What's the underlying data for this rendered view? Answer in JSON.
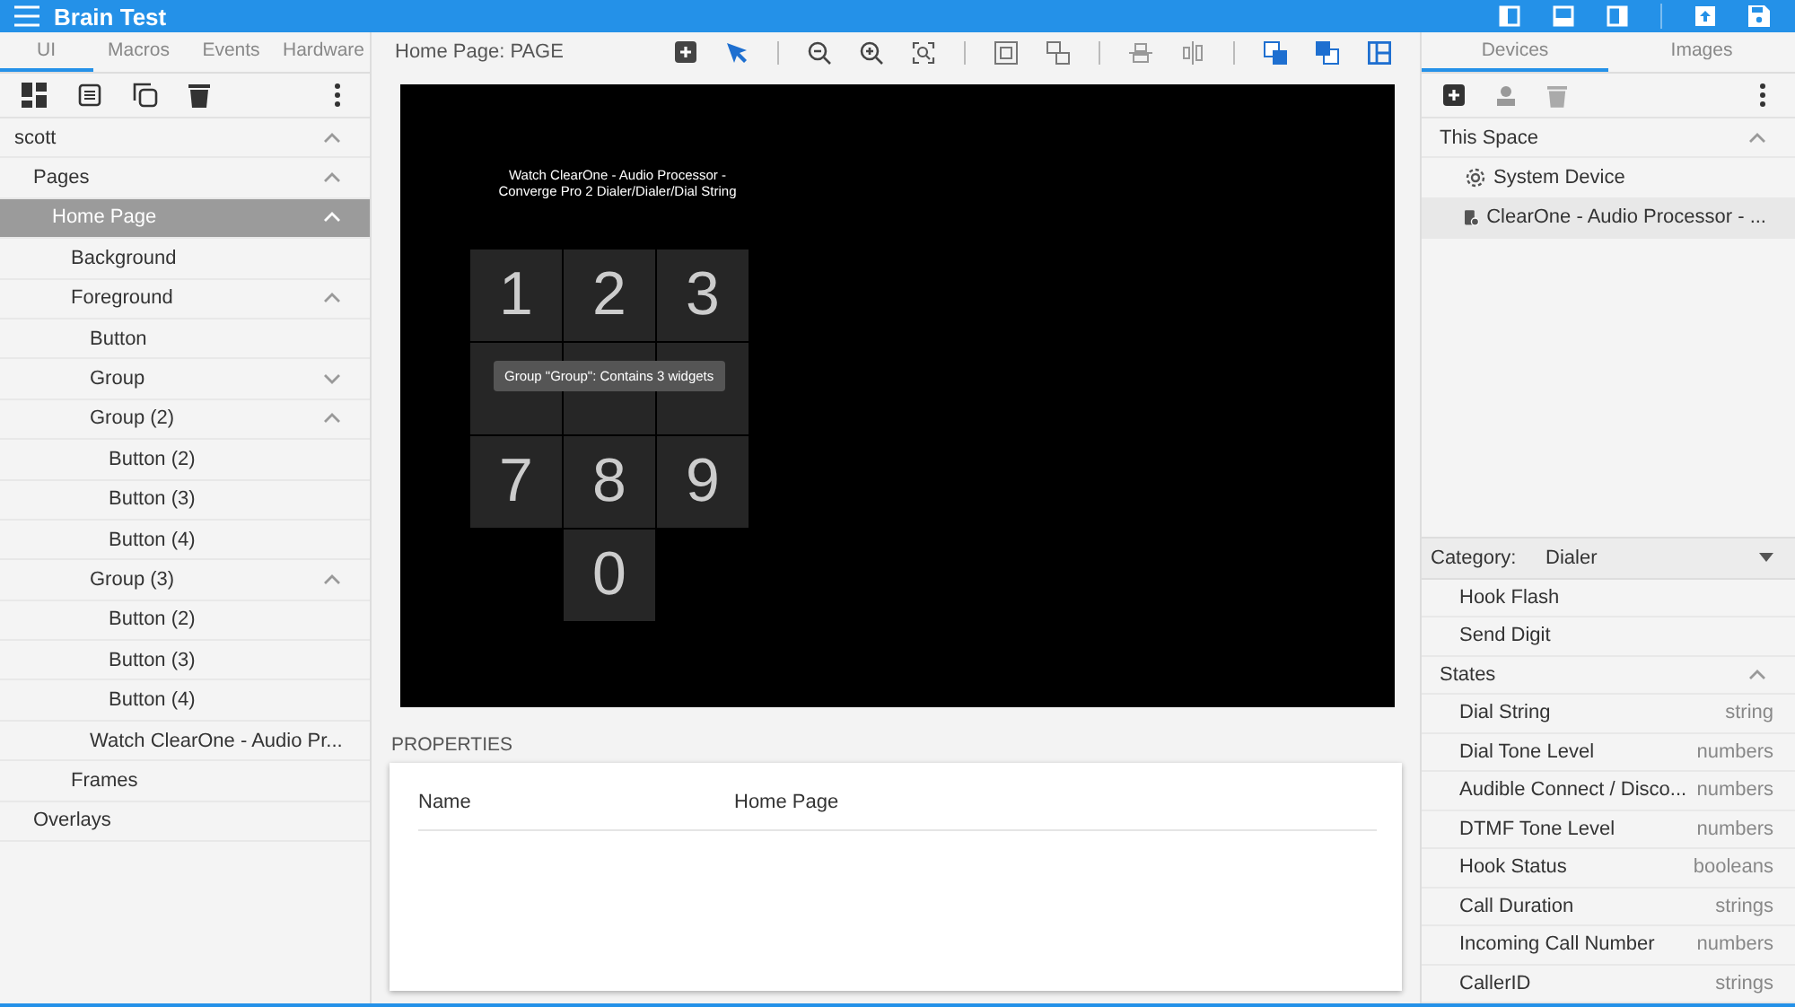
{
  "app_bar": {
    "title": "Brain Test"
  },
  "left_panel": {
    "tabs": [
      {
        "label": "UI",
        "selected": true
      },
      {
        "label": "Macros",
        "selected": false
      },
      {
        "label": "Events",
        "selected": false
      },
      {
        "label": "Hardware",
        "selected": false
      }
    ],
    "tree": [
      {
        "label": "scott",
        "selected": false,
        "expanded": true,
        "children": [
          {
            "label": "Pages",
            "selected": false,
            "expanded": true,
            "children": [
              {
                "label": "Home Page",
                "selected": true,
                "expanded": true,
                "children": [
                  {
                    "label": "Background",
                    "selected": false
                  },
                  {
                    "label": "Foreground",
                    "selected": false,
                    "expanded": true,
                    "children": [
                      {
                        "label": "Button",
                        "selected": false
                      },
                      {
                        "label": "Group",
                        "selected": false,
                        "expanded": false
                      },
                      {
                        "label": "Group (2)",
                        "selected": false,
                        "expanded": true,
                        "children": [
                          {
                            "label": "Button (2)",
                            "selected": false
                          },
                          {
                            "label": "Button (3)",
                            "selected": false
                          },
                          {
                            "label": "Button (4)",
                            "selected": false
                          }
                        ]
                      },
                      {
                        "label": "Group (3)",
                        "selected": false,
                        "expanded": true,
                        "children": [
                          {
                            "label": "Button (2)",
                            "selected": false
                          },
                          {
                            "label": "Button (3)",
                            "selected": false
                          },
                          {
                            "label": "Button (4)",
                            "selected": false
                          }
                        ]
                      },
                      {
                        "label": "Watch ClearOne - Audio Pr...",
                        "selected": false
                      }
                    ]
                  },
                  {
                    "label": "Frames",
                    "selected": false
                  }
                ]
              }
            ]
          },
          {
            "label": "Overlays",
            "selected": false
          }
        ]
      }
    ]
  },
  "editor": {
    "title": "Home Page: PAGE",
    "canvas": {
      "caption": "Watch ClearOne - Audio Processor -\nConverge Pro 2 Dialer/Dialer/Dial String",
      "keys": [
        {
          "kind": "digit",
          "label": "1"
        },
        {
          "kind": "digit",
          "label": "2"
        },
        {
          "kind": "digit",
          "label": "3"
        },
        {
          "kind": "hidden"
        },
        {
          "kind": "hidden"
        },
        {
          "kind": "hidden"
        },
        {
          "kind": "digit",
          "label": "7"
        },
        {
          "kind": "digit",
          "label": "8"
        },
        {
          "kind": "digit",
          "label": "9"
        },
        {
          "kind": "digit",
          "label": "0"
        }
      ],
      "tooltip": "Group \"Group\": Contains 3 widgets"
    },
    "properties": {
      "heading": "PROPERTIES",
      "rows": [
        {
          "name": "Name",
          "value": "Home Page"
        }
      ]
    }
  },
  "right_panel": {
    "tabs": [
      {
        "label": "Devices",
        "selected": true
      },
      {
        "label": "Images",
        "selected": false
      }
    ],
    "space": {
      "title": "This Space",
      "expanded": true,
      "devices": [
        {
          "name": "System Device",
          "kind": "system",
          "selected": false
        },
        {
          "name": "ClearOne - Audio Processor - ...",
          "kind": "processor",
          "selected": true
        }
      ]
    },
    "category": {
      "label": "Category:",
      "value": "Dialer"
    },
    "actions": [
      "Hook Flash",
      "Send Digit"
    ],
    "states": {
      "title": "States",
      "expanded": true,
      "items": [
        {
          "name": "Dial String",
          "type": "string"
        },
        {
          "name": "Dial Tone Level",
          "type": "numbers"
        },
        {
          "name": "Audible Connect / Disco...",
          "type": "numbers"
        },
        {
          "name": "DTMF Tone Level",
          "type": "numbers"
        },
        {
          "name": "Hook Status",
          "type": "booleans"
        },
        {
          "name": "Call Duration",
          "type": "strings"
        },
        {
          "name": "Incoming Call Number",
          "type": "numbers"
        },
        {
          "name": "CallerID",
          "type": "strings"
        }
      ]
    }
  }
}
